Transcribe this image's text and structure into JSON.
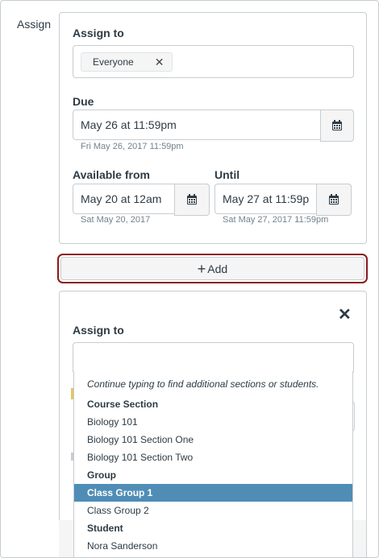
{
  "assign_label": "Assign",
  "card1": {
    "assign_to_heading": "Assign to",
    "assignee_chip": "Everyone",
    "due_heading": "Due",
    "due_value": "May 26 at 11:59pm",
    "due_hint": "Fri May 26, 2017 11:59pm",
    "available_from_heading": "Available from",
    "available_from_value": "May 20 at 12am",
    "available_from_hint": "Sat May 20, 2017",
    "until_heading": "Until",
    "until_value": "May 27 at 11:59p",
    "until_hint": "Sat May 27, 2017 11:59pm"
  },
  "add_button_label": "Add",
  "card2": {
    "assign_to_heading": "Assign to",
    "search_value": ""
  },
  "dropdown": {
    "hint": "Continue typing to find additional sections or students.",
    "course_section_heading": "Course Section",
    "course_sections": [
      "Biology 101",
      "Biology 101 Section One",
      "Biology 101 Section Two"
    ],
    "group_heading": "Group",
    "groups": [
      "Class Group 1",
      "Class Group 2"
    ],
    "selected_group": "Class Group 1",
    "student_heading": "Student",
    "students": [
      "Nora Sanderson"
    ]
  },
  "colors": {
    "selection": "#4f8db7",
    "focus_outline": "#8b1a1a",
    "border": "#c7cdd1",
    "text": "#2d3b45"
  },
  "icons": {
    "calendar": "calendar-icon",
    "remove": "close-icon",
    "plus": "plus-icon"
  }
}
